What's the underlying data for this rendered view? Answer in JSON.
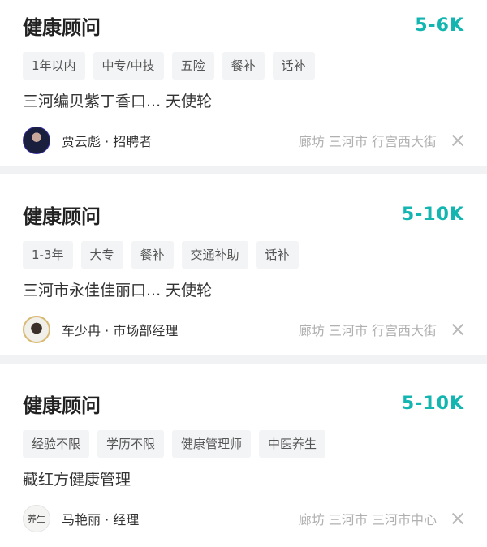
{
  "jobs": [
    {
      "title": "健康顾问",
      "salary": "5-6K",
      "tags": [
        "1年以内",
        "中专/中技",
        "五险",
        "餐补",
        "话补"
      ],
      "company": "三河编贝紫丁香口...   天使轮",
      "recruiter": "贾云彪 · 招聘者",
      "location": "廊坊 三河市 行宫西大街"
    },
    {
      "title": "健康顾问",
      "salary": "5-10K",
      "tags": [
        "1-3年",
        "大专",
        "餐补",
        "交通补助",
        "话补"
      ],
      "company": "三河市永佳佳丽口...   天使轮",
      "recruiter": "车少冉 · 市场部经理",
      "location": "廊坊 三河市 行宫西大街"
    },
    {
      "title": "健康顾问",
      "salary": "5-10K",
      "tags": [
        "经验不限",
        "学历不限",
        "健康管理师",
        "中医养生"
      ],
      "company": "藏红方健康管理",
      "recruiter": "马艳丽 · 经理",
      "location": "廊坊 三河市 三河市中心",
      "avatar_text": "养生"
    }
  ],
  "colors": {
    "salary": "#13b5b1",
    "tag_bg": "#f3f4f6",
    "divider": "#f1f2f4"
  }
}
